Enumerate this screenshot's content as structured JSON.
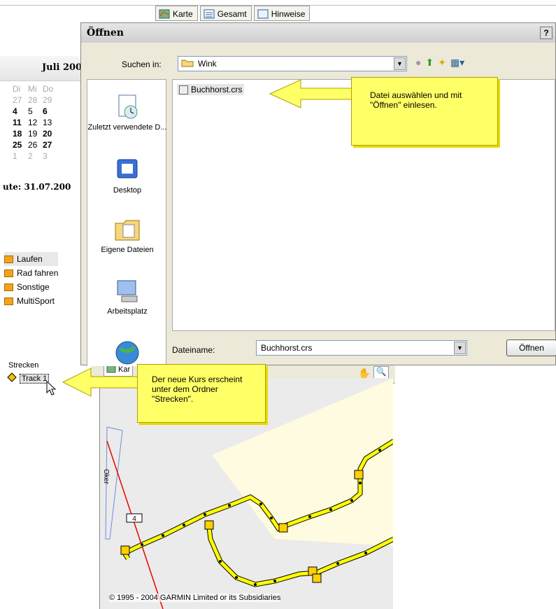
{
  "tabs": [
    "Karte",
    "Gesamt",
    "Hinweise"
  ],
  "calendar": {
    "month": "Juli 200",
    "weekdays": [
      "Di",
      "Mi",
      "Do"
    ],
    "rows": [
      [
        {
          "d": "27",
          "s": "dim"
        },
        {
          "d": "28",
          "s": "dim"
        },
        {
          "d": "29",
          "s": "dim"
        }
      ],
      [
        {
          "d": "4",
          "s": "b"
        },
        {
          "d": "5",
          "s": ""
        },
        {
          "d": "6",
          "s": "b"
        }
      ],
      [
        {
          "d": "11",
          "s": "b"
        },
        {
          "d": "12",
          "s": ""
        },
        {
          "d": "13",
          "s": ""
        }
      ],
      [
        {
          "d": "18",
          "s": "b"
        },
        {
          "d": "19",
          "s": ""
        },
        {
          "d": "20",
          "s": "b"
        }
      ],
      [
        {
          "d": "25",
          "s": "b"
        },
        {
          "d": "26",
          "s": ""
        },
        {
          "d": "27",
          "s": "b"
        }
      ],
      [
        {
          "d": "1",
          "s": "dim"
        },
        {
          "d": "2",
          "s": "dim"
        },
        {
          "d": "3",
          "s": "dim"
        }
      ]
    ],
    "today_label": "ute: 31.07.200"
  },
  "activities": [
    "Laufen",
    "Rad fahren",
    "Sonstige",
    "MultiSport"
  ],
  "tree": {
    "folder": "Strecken",
    "item": "Track 1"
  },
  "dialog": {
    "title": "Öffnen",
    "help": "?",
    "search_label": "Suchen in:",
    "search_value": "Wink",
    "places": [
      "Zuletzt verwendete D...",
      "Desktop",
      "Eigene Dateien",
      "Arbeitsplatz"
    ],
    "file": "Buchhorst.crs",
    "filename_label": "Dateiname:",
    "filename_value": "Buchhorst.crs",
    "open_button": "Öffnen"
  },
  "callouts": {
    "top": "Datei auswählen und mit \"Öffnen\" einlesen.",
    "bottom": "Der neue Kurs erscheint unter dem Ordner  \"Strecken\"."
  },
  "lower_tab": "Kar",
  "map": {
    "copyright": "© 1995 - 2004 GARMIN Limited or its Subsidiaries",
    "road_label": "4",
    "street": "Oker"
  },
  "colors": {
    "callout": "#ffff66",
    "route": "#ffff00",
    "map_bg": "#ebebeb",
    "area": "#fffbe0"
  }
}
